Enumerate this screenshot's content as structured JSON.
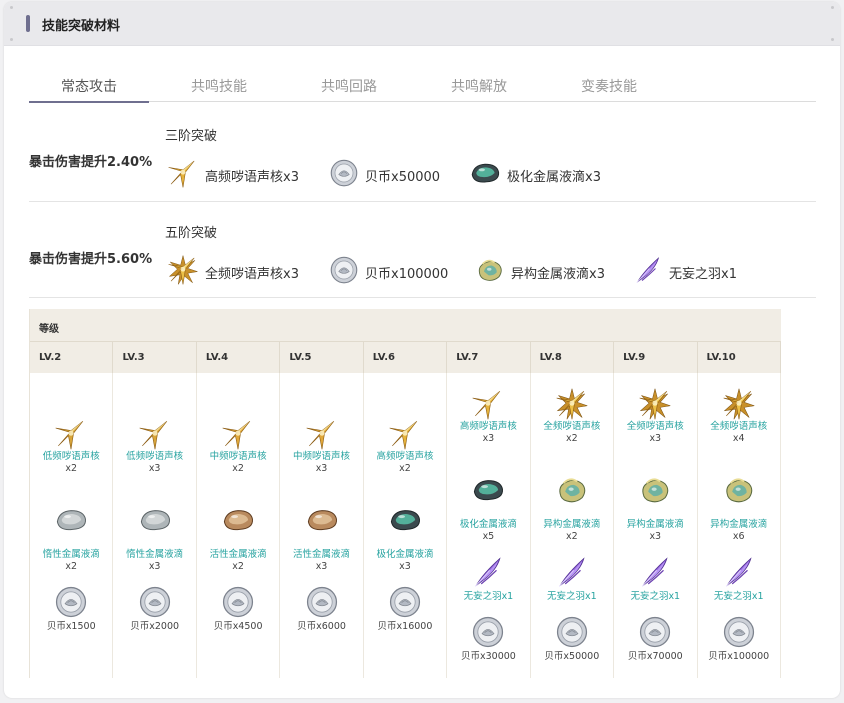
{
  "header": {
    "title": "技能突破材料"
  },
  "tabs": [
    {
      "label": "常态攻击",
      "active": true
    },
    {
      "label": "共鸣技能",
      "active": false
    },
    {
      "label": "共鸣回路",
      "active": false
    },
    {
      "label": "共鸣解放",
      "active": false
    },
    {
      "label": "变奏技能",
      "active": false
    }
  ],
  "breakthroughs": [
    {
      "effect": "暴击伤害提升2.40%",
      "stage": "三阶突破",
      "materials": [
        {
          "icon": "star-core-icon",
          "label": "高频哕语声核x3"
        },
        {
          "icon": "coin-icon",
          "label": "贝币x50000"
        },
        {
          "icon": "polar-liquid-icon",
          "label": "极化金属液滴x3"
        }
      ]
    },
    {
      "effect": "暴击伤害提升5.60%",
      "stage": "五阶突破",
      "materials": [
        {
          "icon": "star-core-full-icon",
          "label": "全频哕语声核x3"
        },
        {
          "icon": "coin-icon",
          "label": "贝币x100000"
        },
        {
          "icon": "hetero-liquid-icon",
          "label": "异构金属液滴x3"
        },
        {
          "icon": "feather-icon",
          "label": "无妄之羽x1"
        }
      ]
    }
  ],
  "table": {
    "title": "等级",
    "columns": [
      {
        "level": "LV.2",
        "items": [
          {
            "type": "core_low",
            "name": "低频哕语声核",
            "count": "x2"
          },
          {
            "type": "inert",
            "name": "惰性金属液滴",
            "count": "x2"
          },
          {
            "type": "coin",
            "name": "贝币x1500",
            "count": ""
          }
        ]
      },
      {
        "level": "LV.3",
        "items": [
          {
            "type": "core_low",
            "name": "低频哕语声核",
            "count": "x3"
          },
          {
            "type": "inert",
            "name": "惰性金属液滴",
            "count": "x3"
          },
          {
            "type": "coin",
            "name": "贝币x2000",
            "count": ""
          }
        ]
      },
      {
        "level": "LV.4",
        "items": [
          {
            "type": "core_mid",
            "name": "中频哕语声核",
            "count": "x2"
          },
          {
            "type": "active",
            "name": "活性金属液滴",
            "count": "x2"
          },
          {
            "type": "coin",
            "name": "贝币x4500",
            "count": ""
          }
        ]
      },
      {
        "level": "LV.5",
        "items": [
          {
            "type": "core_mid",
            "name": "中频哕语声核",
            "count": "x3"
          },
          {
            "type": "active",
            "name": "活性金属液滴",
            "count": "x3"
          },
          {
            "type": "coin",
            "name": "贝币x6000",
            "count": ""
          }
        ]
      },
      {
        "level": "LV.6",
        "items": [
          {
            "type": "core_high",
            "name": "高频哕语声核",
            "count": "x2"
          },
          {
            "type": "polar",
            "name": "极化金属液滴",
            "count": "x3"
          },
          {
            "type": "coin",
            "name": "贝币x16000",
            "count": ""
          }
        ]
      },
      {
        "level": "LV.7",
        "items": [
          {
            "type": "core_high",
            "name": "高频哕语声核",
            "count": "x3"
          },
          {
            "type": "polar",
            "name": "极化金属液滴",
            "count": "x5"
          },
          {
            "type": "feather",
            "name": "无妄之羽x1",
            "count": ""
          },
          {
            "type": "coin",
            "name": "贝币x30000",
            "count": ""
          }
        ]
      },
      {
        "level": "LV.8",
        "items": [
          {
            "type": "core_full",
            "name": "全频哕语声核",
            "count": "x2"
          },
          {
            "type": "hetero",
            "name": "异构金属液滴",
            "count": "x2"
          },
          {
            "type": "feather",
            "name": "无妄之羽x1",
            "count": ""
          },
          {
            "type": "coin",
            "name": "贝币x50000",
            "count": ""
          }
        ]
      },
      {
        "level": "LV.9",
        "items": [
          {
            "type": "core_full",
            "name": "全频哕语声核",
            "count": "x3"
          },
          {
            "type": "hetero",
            "name": "异构金属液滴",
            "count": "x3"
          },
          {
            "type": "feather",
            "name": "无妄之羽x1",
            "count": ""
          },
          {
            "type": "coin",
            "name": "贝币x70000",
            "count": ""
          }
        ]
      },
      {
        "level": "LV.10",
        "items": [
          {
            "type": "core_full",
            "name": "全频哕语声核",
            "count": "x4"
          },
          {
            "type": "hetero",
            "name": "异构金属液滴",
            "count": "x6"
          },
          {
            "type": "feather",
            "name": "无妄之羽x1",
            "count": ""
          },
          {
            "type": "coin",
            "name": "贝币x100000",
            "count": ""
          }
        ]
      }
    ]
  },
  "colors": {
    "accent": "#6f6f8f",
    "link": "#27a3a0",
    "tableHeader": "#f1ede5"
  }
}
